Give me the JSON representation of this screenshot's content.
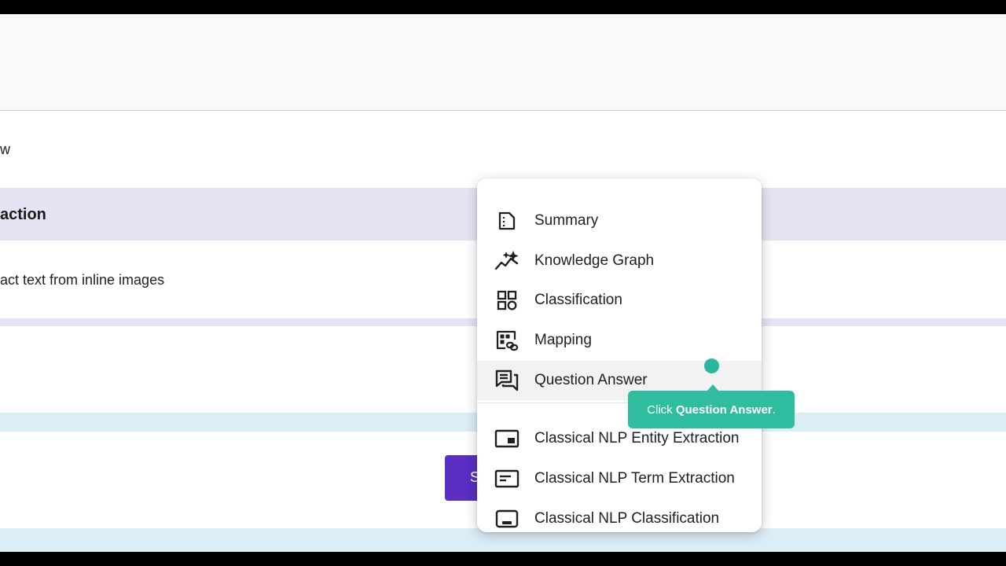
{
  "page": {
    "partial_label": "w",
    "section_title": "action",
    "option_text": "act text from inline images",
    "cta_partial_label": "S"
  },
  "menu": {
    "items": [
      {
        "label": "Summary",
        "icon": "summary-document-icon"
      },
      {
        "label": "Knowledge Graph",
        "icon": "knowledge-graph-sparkle-icon"
      },
      {
        "label": "Classification",
        "icon": "category-grid-icon"
      },
      {
        "label": "Mapping",
        "icon": "mapping-link-icon"
      },
      {
        "label": "Question Answer",
        "icon": "question-answer-chat-icon",
        "highlighted": true
      },
      {
        "label": "Classical NLP Entity Extraction",
        "icon": "entity-extraction-icon"
      },
      {
        "label": "Classical NLP Term Extraction",
        "icon": "term-extraction-icon"
      },
      {
        "label": "Classical NLP Classification",
        "icon": "nlp-classification-icon"
      }
    ]
  },
  "tooltip": {
    "prefix": "Click ",
    "target": "Question Answer",
    "suffix": "."
  },
  "colors": {
    "accent_purple": "#5a2fc2",
    "band_purple": "#e6e3f3",
    "band_blue": "#dbeef8",
    "tooltip_teal": "#2fbc9f"
  }
}
